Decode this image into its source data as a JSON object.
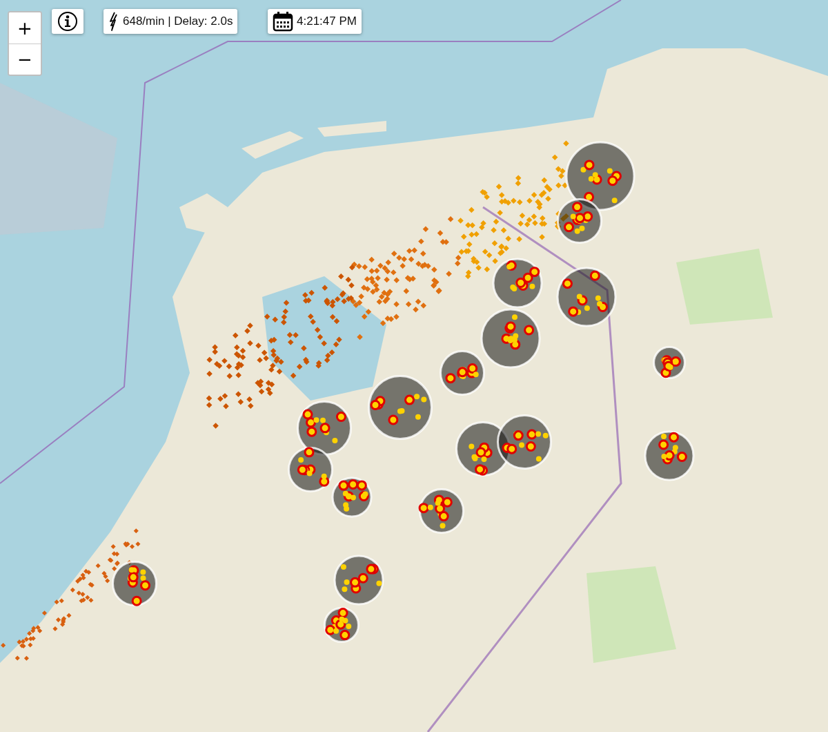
{
  "zoom_controls": [
    {
      "label": "+"
    },
    {
      "label": "−"
    }
  ],
  "status": {
    "text": "648/min | Delay: 2.0s"
  },
  "clock": {
    "time": "4:21:47 PM"
  }
}
